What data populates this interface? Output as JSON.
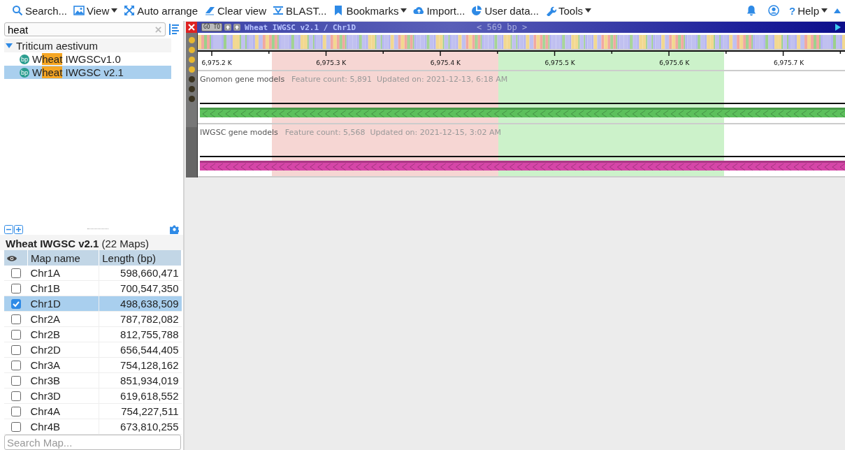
{
  "toolbar": {
    "items": [
      {
        "label": "Search...",
        "dropdown": false
      },
      {
        "label": "View",
        "dropdown": true
      },
      {
        "label": "Auto arrange",
        "dropdown": false
      },
      {
        "label": "Clear view",
        "dropdown": false
      },
      {
        "label": "BLAST...",
        "dropdown": false
      },
      {
        "label": "Bookmarks",
        "dropdown": true
      },
      {
        "label": "Import...",
        "dropdown": false
      },
      {
        "label": "User data...",
        "dropdown": false
      },
      {
        "label": "Tools",
        "dropdown": true
      }
    ],
    "help": {
      "mark": "?",
      "label": "Help",
      "dropdown": true
    }
  },
  "search": {
    "value": "heat"
  },
  "tree": [
    {
      "label": "Triticum aestivum",
      "expanded": true,
      "children": [
        {
          "badge": "bp",
          "before": "W",
          "match": "heat",
          "after": " IWGSCv1.0",
          "selected": false
        },
        {
          "badge": "bp",
          "before": "W",
          "match": "heat",
          "after": " IWGSC v2.1",
          "selected": true
        }
      ]
    }
  ],
  "map_table": {
    "heading": "**Wheat IWGSC v2.1** (22 Maps)",
    "columns": [
      "Map name",
      "Length (bp)"
    ],
    "rows": [
      {
        "name": "Chr1A",
        "length": "598,660,471",
        "checked": false,
        "selected": false
      },
      {
        "name": "Chr1B",
        "length": "700,547,350",
        "checked": false,
        "selected": false
      },
      {
        "name": "Chr1D",
        "length": "498,638,509",
        "checked": true,
        "selected": true
      },
      {
        "name": "Chr2A",
        "length": "787,782,082",
        "checked": false,
        "selected": false
      },
      {
        "name": "Chr2B",
        "length": "812,755,788",
        "checked": false,
        "selected": false
      },
      {
        "name": "Chr2D",
        "length": "656,544,405",
        "checked": false,
        "selected": false
      },
      {
        "name": "Chr3A",
        "length": "754,128,162",
        "checked": false,
        "selected": false
      },
      {
        "name": "Chr3B",
        "length": "851,934,019",
        "checked": false,
        "selected": false
      },
      {
        "name": "Chr3D",
        "length": "619,618,552",
        "checked": false,
        "selected": false
      },
      {
        "name": "Chr4A",
        "length": "754,227,511",
        "checked": false,
        "selected": false
      },
      {
        "name": "Chr4B",
        "length": "673,810,255",
        "checked": false,
        "selected": false
      }
    ],
    "search_placeholder": "Search Map..."
  },
  "viewer": {
    "goto": "GO TO",
    "title": "Wheat IWGSC v2.1 / Chr1D",
    "span": "< 569 bp >",
    "ruler": [
      "6,975.2 K",
      "6,975.3 K",
      "6,975.4 K",
      "6,975.5 K",
      "6,975.6 K",
      "6,975.7 K"
    ],
    "highlights": [
      {
        "color": "#f6d6d3"
      },
      {
        "color": "#ccf2ca"
      }
    ],
    "tracks": [
      {
        "name": "Gnomon gene models",
        "info": "Feature count: 5,891  Updated on: 2021-12-13, 6:18 AM",
        "color": "#5cc05c"
      },
      {
        "name": "IWGSC gene models",
        "info": "Feature count: 5,568  Updated on: 2021-12-15, 3:02 AM",
        "color": "#d646a8"
      }
    ]
  }
}
